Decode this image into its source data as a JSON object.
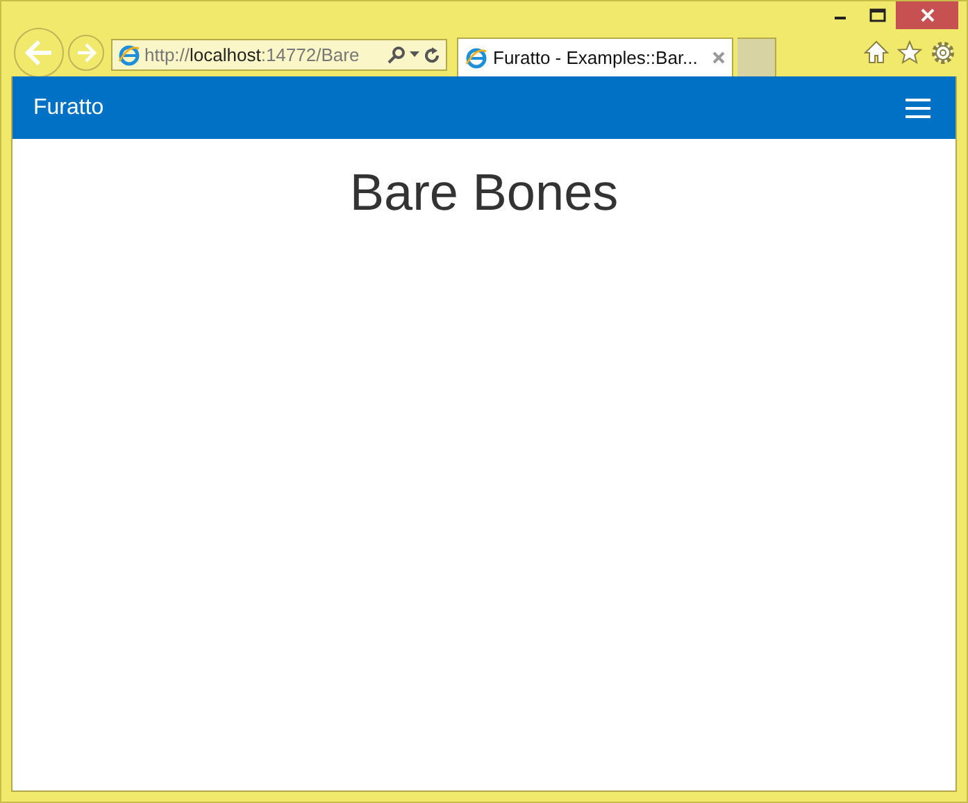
{
  "browser": {
    "address": {
      "scheme": "http://",
      "host": "localhost",
      "rest": ":14772/Bare"
    },
    "tabs": [
      {
        "title": "Furatto - Examples::Bar...",
        "selected": true
      }
    ]
  },
  "navbar": {
    "brand": "Furatto"
  },
  "page": {
    "heading": "Bare Bones"
  }
}
